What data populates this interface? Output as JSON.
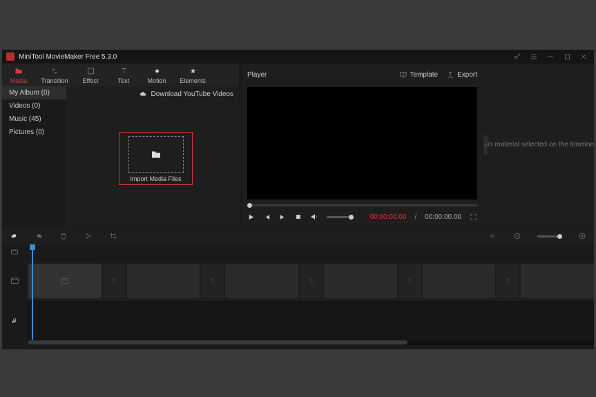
{
  "titlebar": {
    "title": "MiniTool MovieMaker Free 5.3.0"
  },
  "tool_tabs": {
    "media": "Media",
    "transition": "Transition",
    "effect": "Effect",
    "text": "Text",
    "motion": "Motion",
    "elements": "Elements"
  },
  "media_sidebar": {
    "my_album": "My Album (0)",
    "videos": "Videos (0)",
    "music": "Music (45)",
    "pictures": "Pictures (0)"
  },
  "media_panel": {
    "download_link": "Download YouTube Videos",
    "import_label": "Import Media Files"
  },
  "player": {
    "title": "Player",
    "template_btn": "Template",
    "export_btn": "Export",
    "current_time": "00:00:00.00",
    "separator": "/",
    "total_time": "00:00:00.00"
  },
  "inspector": {
    "empty_text": "No material selected on the timeline"
  }
}
